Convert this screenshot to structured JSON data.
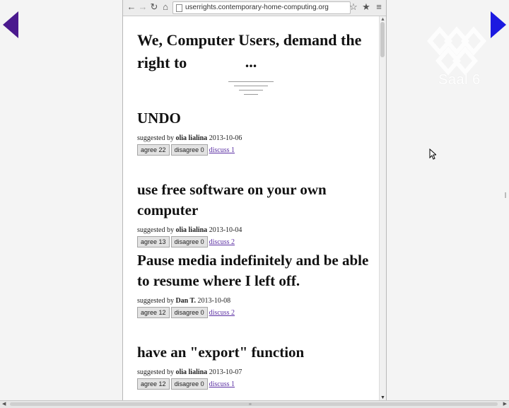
{
  "browser": {
    "url": "userrights.contemporary-home-computing.org",
    "back_icon": "arrow-left",
    "forward_icon": "arrow-right",
    "reload_icon": "reload",
    "home_icon": "home",
    "menu_icon": "hamburger"
  },
  "page": {
    "heading": "We, Computer Users, demand the right to",
    "ellipsis": "..."
  },
  "overlay": {
    "logo_label": "Saal 6"
  },
  "labels": {
    "suggested_by": "suggested by",
    "agree": "agree",
    "disagree": "disagree",
    "discuss": "discuss"
  },
  "items": [
    {
      "title": "UNDO",
      "author": "olia lialina",
      "date": "2013-10-06",
      "agree": "22",
      "disagree": "0",
      "discuss": "1"
    },
    {
      "title": "use free software on your own computer",
      "author": "olia lialina",
      "date": "2013-10-04",
      "agree": "13",
      "disagree": "0",
      "discuss": "2"
    },
    {
      "title": "Pause media indefinitely and be able to resume where I left off.",
      "author": "Dan T.",
      "date": "2013-10-08",
      "agree": "12",
      "disagree": "0",
      "discuss": "2"
    },
    {
      "title": "have an \"export\" function",
      "author": "olia lialina",
      "date": "2013-10-07",
      "agree": "12",
      "disagree": "0",
      "discuss": "1"
    }
  ],
  "colors": {
    "nav_left": "#4b1a8e",
    "nav_right": "#1c1ae0",
    "link": "#5b2fa3"
  }
}
